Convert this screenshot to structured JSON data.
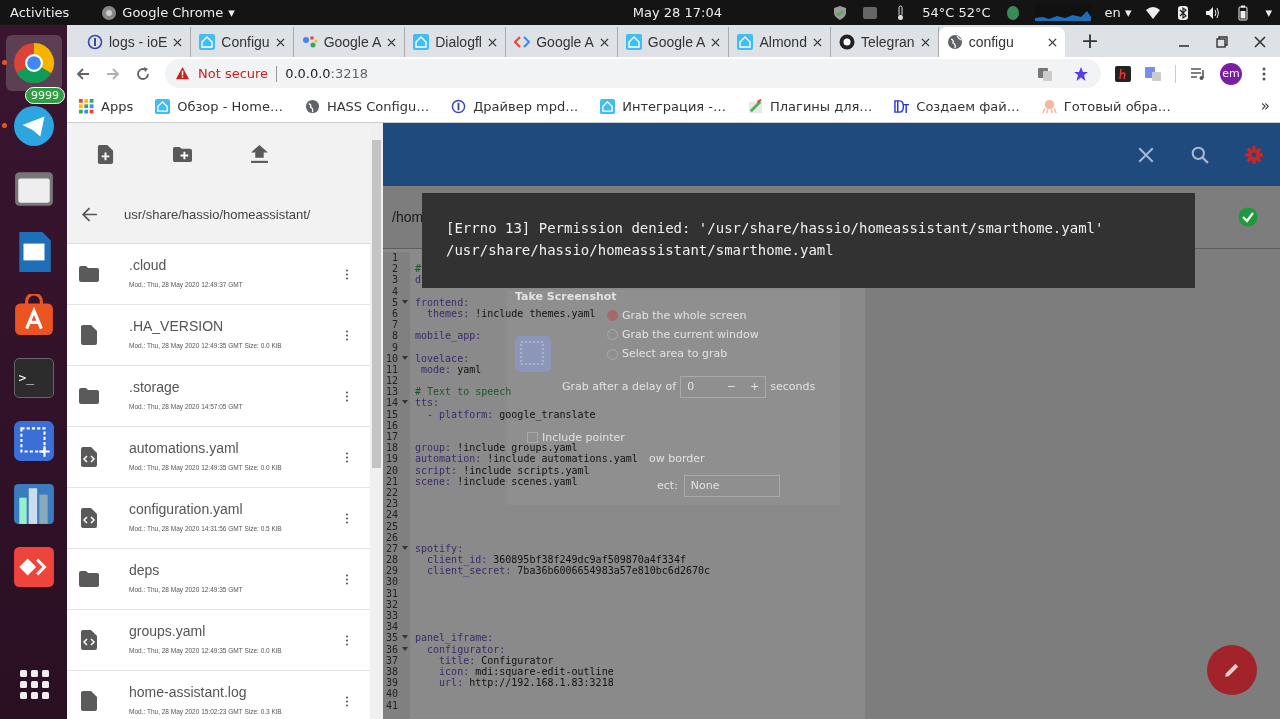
{
  "top_bar": {
    "activities": "Activities",
    "app_menu": "Google Chrome",
    "app_menu_caret": "▾",
    "clock": "May 28  17:04",
    "temperature": "54°C 52°C",
    "language": "en",
    "language_caret": "▾",
    "system_caret": "▾"
  },
  "dock": [
    {
      "kind": "chrome",
      "running": true
    },
    {
      "kind": "telegram",
      "running": true,
      "badge": "9999"
    },
    {
      "kind": "files",
      "running": false
    },
    {
      "kind": "writer",
      "running": false
    },
    {
      "kind": "store",
      "running": false
    },
    {
      "kind": "terminal",
      "running": false,
      "glyph": ">_"
    },
    {
      "kind": "screenshot",
      "running": false
    },
    {
      "kind": "cities",
      "running": false
    },
    {
      "kind": "anydesk",
      "running": false
    },
    {
      "kind": "grid",
      "running": false
    }
  ],
  "tabs": [
    {
      "title": "logs - ioE",
      "kind": "info",
      "selected": false
    },
    {
      "title": "Configu",
      "kind": "home",
      "selected": false
    },
    {
      "title": "Google A",
      "kind": "assistant",
      "selected": false
    },
    {
      "title": "Dialogfl",
      "kind": "home",
      "selected": false
    },
    {
      "title": "Google A",
      "kind": "code",
      "selected": false
    },
    {
      "title": "Google A",
      "kind": "home",
      "selected": false
    },
    {
      "title": "Almond",
      "kind": "home",
      "selected": false
    },
    {
      "title": "Telegran",
      "kind": "github",
      "selected": false
    },
    {
      "title": "configu",
      "kind": "globe",
      "selected": true
    }
  ],
  "new_tab": "+",
  "address_bar": {
    "warning": "Not secure",
    "host": "0.0.0.0",
    "port": ":3218"
  },
  "profile": "em",
  "bookmarks": [
    {
      "label": "Apps",
      "kind": "apps"
    },
    {
      "label": "Обзор - Home…",
      "kind": "home"
    },
    {
      "label": "HASS Configu…",
      "kind": "globe"
    },
    {
      "label": "Драйвер mpd…",
      "kind": "info"
    },
    {
      "label": "Интеграция -…",
      "kind": "home"
    },
    {
      "label": "Плагины для…",
      "kind": "plugin"
    },
    {
      "label": "Создаем фай…",
      "kind": "dt"
    },
    {
      "label": "Готовый обра…",
      "kind": "octopus"
    }
  ],
  "bookmarks_more": "»",
  "file_browser": {
    "path": "usr/share/hassio/homeassistant/",
    "items": [
      {
        "name": ".cloud",
        "kind": "folder",
        "meta": "Mod.: Thu, 28 May 2020 12:49:37 GMT"
      },
      {
        "name": ".HA_VERSION",
        "kind": "file",
        "meta": "Mod.: Thu, 28 May 2020 12:49:35 GMT  Size: 0.0 KiB"
      },
      {
        "name": ".storage",
        "kind": "folder",
        "meta": "Mod.: Thu, 28 May 2020 14:57:05 GMT"
      },
      {
        "name": "automations.yaml",
        "kind": "code",
        "meta": "Mod.: Thu, 28 May 2020 12:49:35 GMT  Size: 0.0 KiB"
      },
      {
        "name": "configuration.yaml",
        "kind": "code",
        "meta": "Mod.: Thu, 28 May 2020 14:31:56 GMT  Size: 0.5 KiB"
      },
      {
        "name": "deps",
        "kind": "folder",
        "meta": "Mod.: Thu, 28 May 2020 12:49:35 GMT"
      },
      {
        "name": "groups.yaml",
        "kind": "code",
        "meta": "Mod.: Thu, 28 May 2020 12:49:35 GMT  Size: 0.0 KiB"
      },
      {
        "name": "home-assistant.log",
        "kind": "file",
        "meta": "Mod.: Thu, 28 May 2020 15:02:23 GMT  Size: 0.3 KiB"
      }
    ]
  },
  "editor": {
    "path": "/hom",
    "saved": true,
    "lines": [
      {
        "n": "1"
      },
      {
        "n": "2",
        "text": "#",
        "kind": "comment"
      },
      {
        "n": "3",
        "text": "d"
      },
      {
        "n": "4"
      },
      {
        "n": "5",
        "text": "frontend:",
        "fold": true
      },
      {
        "n": "6",
        "text": "  themes: !include themes.yaml"
      },
      {
        "n": "7"
      },
      {
        "n": "8",
        "text": "mobile_app:"
      },
      {
        "n": "9"
      },
      {
        "n": "10",
        "text": "lovelace:",
        "fold": true
      },
      {
        "n": "11",
        "text": " mode: yaml"
      },
      {
        "n": "12"
      },
      {
        "n": "13",
        "text": "# Text to speech",
        "kind": "comment"
      },
      {
        "n": "14",
        "text": "tts:",
        "fold": true
      },
      {
        "n": "15",
        "text": "  - platform: google_translate"
      },
      {
        "n": "16"
      },
      {
        "n": "17"
      },
      {
        "n": "18",
        "text": "group: !include groups.yaml"
      },
      {
        "n": "19",
        "text": "automation: !include automations.yaml"
      },
      {
        "n": "20",
        "text": "script: !include scripts.yaml"
      },
      {
        "n": "21",
        "text": "scene: !include scenes.yaml"
      },
      {
        "n": "22"
      },
      {
        "n": "23"
      },
      {
        "n": "24"
      },
      {
        "n": "25"
      },
      {
        "n": "26"
      },
      {
        "n": "27",
        "text": "spotify:",
        "fold": true
      },
      {
        "n": "28",
        "text": "  client_id: 360895bf38f249dc9af509870a4f334f"
      },
      {
        "n": "29",
        "text": "  client_secret: 7ba36b6006654983a57e810bc6d2670c"
      },
      {
        "n": "30"
      },
      {
        "n": "31"
      },
      {
        "n": "32"
      },
      {
        "n": "33"
      },
      {
        "n": "34"
      },
      {
        "n": "35",
        "text": "panel_iframe:",
        "fold": true
      },
      {
        "n": "36",
        "text": "  configurator:",
        "fold": true
      },
      {
        "n": "37",
        "text": "    title: Configurator"
      },
      {
        "n": "38",
        "text": "    icon: mdi:square-edit-outline"
      },
      {
        "n": "39",
        "text": "    url: http://192.168.1.83:3218"
      },
      {
        "n": "40"
      },
      {
        "n": "41"
      }
    ]
  },
  "screenshot_dialog": {
    "title": "Take Screenshot",
    "options": [
      {
        "label": "Grab the whole screen",
        "selected": true
      },
      {
        "label": "Grab the current window",
        "selected": false
      },
      {
        "label": "Select area to grab",
        "selected": false
      }
    ],
    "delay_label": "Grab after a delay of",
    "delay_value": "0",
    "minus": "−",
    "plus": "+",
    "delay_unit": "seconds",
    "include_pointer": {
      "label": "Include pointer",
      "checked": false
    },
    "border_fragment": "ow border",
    "effect_fragment": "ect:",
    "effect_value": "None"
  },
  "snackbar": {
    "lines": [
      "[Errno 13] Permission denied: '/usr/share/hassio/homeassistant/smarthome.yaml'",
      "/usr/share/hassio/homeassistant/smarthome.yaml"
    ]
  }
}
